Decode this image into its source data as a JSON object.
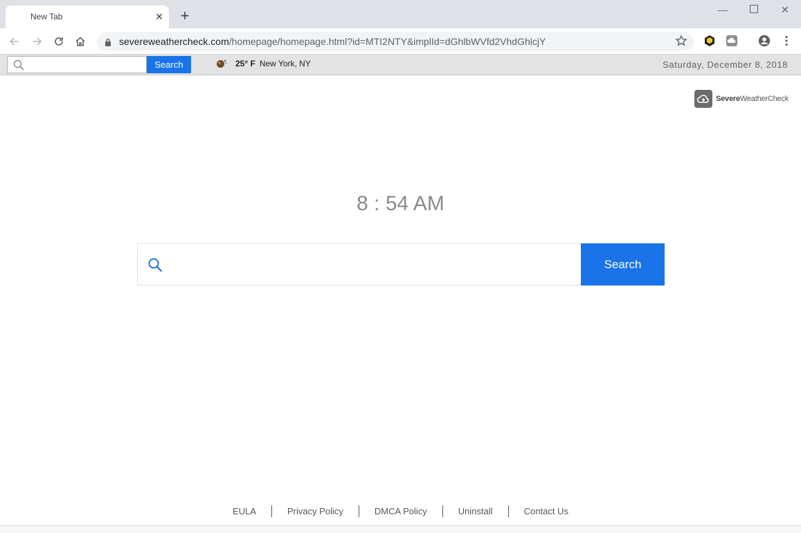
{
  "browser": {
    "tab_title": "New Tab",
    "url_host": "severeweathercheck.com",
    "url_path": "/homepage/homepage.html?id=MTI2NTY&implId=dGhlbWVfd2VhdGhlcjY"
  },
  "extbar": {
    "search_button_label": "Search",
    "temperature": "25° F",
    "location": "New York, NY",
    "date": "Saturday, December 8, 2018"
  },
  "brand": {
    "name_bold": "Severe",
    "name_rest": "WeatherCheck"
  },
  "main": {
    "clock": "8 : 54 AM",
    "search_button_label": "Search",
    "search_value": ""
  },
  "footer": {
    "links": [
      "EULA",
      "Privacy Policy",
      "DMCA Policy",
      "Uninstall",
      "Contact Us"
    ]
  },
  "colors": {
    "accent": "#1a73e8",
    "chrome_bg": "#dee1e6",
    "extbar_bg": "#e3e3e3",
    "clock_text": "#8a8a8a"
  },
  "icons": [
    "back-icon",
    "forward-icon",
    "reload-icon",
    "home-icon",
    "lock-icon",
    "star-icon",
    "profile-icon",
    "menu-icon",
    "search-icon",
    "weather-icon",
    "cloud-logo-icon"
  ]
}
